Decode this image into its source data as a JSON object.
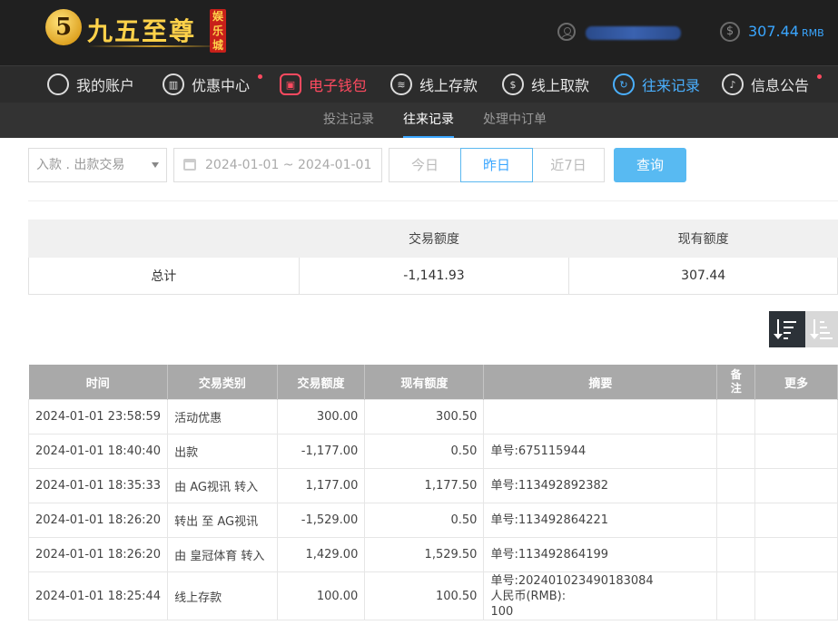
{
  "header": {
    "logo_glyph": "5",
    "logo_text": "九五至尊",
    "logo_tag": "娱乐城",
    "dollar_glyph": "$",
    "balance": "307.44",
    "currency": "RMB"
  },
  "nav": [
    {
      "label": "我的账户",
      "icon": "user-icon",
      "glyph": ""
    },
    {
      "label": "优惠中心",
      "icon": "gift-icon",
      "glyph": "▥"
    },
    {
      "label": "电子钱包",
      "icon": "wallet-icon",
      "glyph": "▣"
    },
    {
      "label": "线上存款",
      "icon": "deposit-icon",
      "glyph": "≋"
    },
    {
      "label": "线上取款",
      "icon": "withdraw-icon",
      "glyph": "$"
    },
    {
      "label": "往来记录",
      "icon": "records-icon",
      "glyph": "↻"
    },
    {
      "label": "信息公告",
      "icon": "bell-icon",
      "glyph": "♪"
    }
  ],
  "subnav": [
    "投注记录",
    "往来记录",
    "处理中订单"
  ],
  "filters": {
    "type_select": "入款 . 出款交易",
    "date_range": "2024-01-01 ~ 2024-01-01",
    "quick": [
      "今日",
      "昨日",
      "近7日"
    ],
    "query_label": "查询"
  },
  "summary": {
    "headers": [
      "",
      "交易额度",
      "现有额度"
    ],
    "row": [
      "总计",
      "-1,141.93",
      "307.44"
    ]
  },
  "table": {
    "headers": [
      "时间",
      "交易类别",
      "交易额度",
      "现有额度",
      "摘要",
      "备注",
      "更多"
    ],
    "rows": [
      {
        "time": "2024-01-01 23:58:59",
        "type": "活动优惠",
        "amount": "300.00",
        "balance": "300.50",
        "summary": [
          "",
          "",
          ""
        ]
      },
      {
        "time": "2024-01-01 18:40:40",
        "type": "出款",
        "amount": "-1,177.00",
        "balance": "0.50",
        "summary": [
          "单号:675115944",
          "",
          ""
        ]
      },
      {
        "time": "2024-01-01 18:35:33",
        "type": "由 AG视讯 转入",
        "amount": "1,177.00",
        "balance": "1,177.50",
        "summary": [
          "单号:113492892382",
          "",
          ""
        ]
      },
      {
        "time": "2024-01-01 18:26:20",
        "type": "转出 至 AG视讯",
        "amount": "-1,529.00",
        "balance": "0.50",
        "summary": [
          "单号:113492864221",
          "",
          ""
        ]
      },
      {
        "time": "2024-01-01 18:26:20",
        "type": "由 皇冠体育 转入",
        "amount": "1,429.00",
        "balance": "1,529.50",
        "summary": [
          "单号:113492864199",
          "",
          ""
        ]
      },
      {
        "time": "2024-01-01 18:25:44",
        "type": "线上存款",
        "amount": "100.00",
        "balance": "100.50",
        "summary": [
          "单号:202401023490183084",
          "人民币(RMB):",
          "100"
        ]
      }
    ]
  }
}
